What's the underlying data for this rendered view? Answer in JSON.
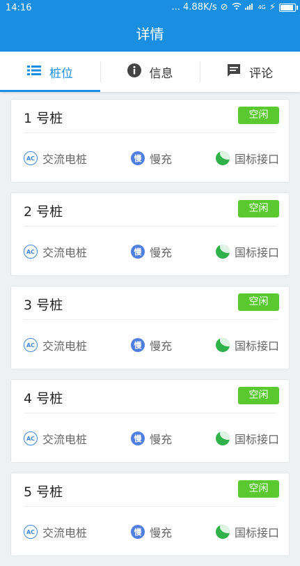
{
  "status": {
    "time": "14:16",
    "speed": "... 4.88K/s",
    "lte": "4G"
  },
  "appbar": {
    "title": "详情"
  },
  "tabs": [
    {
      "label": "桩位",
      "icon": "list-icon"
    },
    {
      "label": "信息",
      "icon": "info-icon"
    },
    {
      "label": "评论",
      "icon": "comment-icon"
    }
  ],
  "piles": [
    {
      "name": "1 号桩",
      "status": "空闲",
      "type": "交流电桩",
      "speed": "慢充",
      "iface": "国标接口",
      "slow_glyph": "慢",
      "ac_glyph": "AC"
    },
    {
      "name": "2 号桩",
      "status": "空闲",
      "type": "交流电桩",
      "speed": "慢充",
      "iface": "国标接口",
      "slow_glyph": "慢",
      "ac_glyph": "AC"
    },
    {
      "name": "3 号桩",
      "status": "空闲",
      "type": "交流电桩",
      "speed": "慢充",
      "iface": "国标接口",
      "slow_glyph": "慢",
      "ac_glyph": "AC"
    },
    {
      "name": "4 号桩",
      "status": "空闲",
      "type": "交流电桩",
      "speed": "慢充",
      "iface": "国标接口",
      "slow_glyph": "慢",
      "ac_glyph": "AC"
    },
    {
      "name": "5 号桩",
      "status": "空闲",
      "type": "交流电桩",
      "speed": "慢充",
      "iface": "国标接口",
      "slow_glyph": "慢",
      "ac_glyph": "AC"
    }
  ],
  "colors": {
    "primary": "#1a8ee0",
    "status_free": "#5ac92f"
  }
}
